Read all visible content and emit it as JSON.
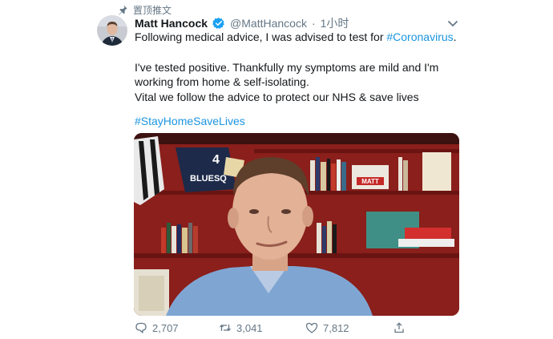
{
  "pinned_label": "置顶推文",
  "icons": {
    "pin": "pin-icon",
    "verified": "verified-badge-icon",
    "chevron": "chevron-down-icon",
    "reply": "reply-icon",
    "retweet": "retweet-icon",
    "like": "heart-icon",
    "share": "share-icon"
  },
  "colors": {
    "link": "#1b95e0",
    "muted": "#657786",
    "verified": "#1da1f2"
  },
  "tweet": {
    "author_name": "Matt Hancock",
    "handle": "@MattHancock",
    "separator": "·",
    "time": "1小时",
    "line1_text": "Following medical advice, I was advised to test for ",
    "line1_hashtag": "#Coronavirus",
    "line1_end": ".",
    "paragraph2": "I've tested positive. Thankfully my symptoms are mild and I'm working from home & self-isolating.",
    "paragraph3": "Vital we follow the advice to protect our NHS & save lives",
    "hashtag2": "#StayHomeSaveLives"
  },
  "media_text": {
    "shirt_text": "BLUESQ",
    "shirt_number": "4",
    "box_label": "MATT"
  },
  "actions": {
    "replies": "2,707",
    "retweets": "3,041",
    "likes": "7,812"
  }
}
